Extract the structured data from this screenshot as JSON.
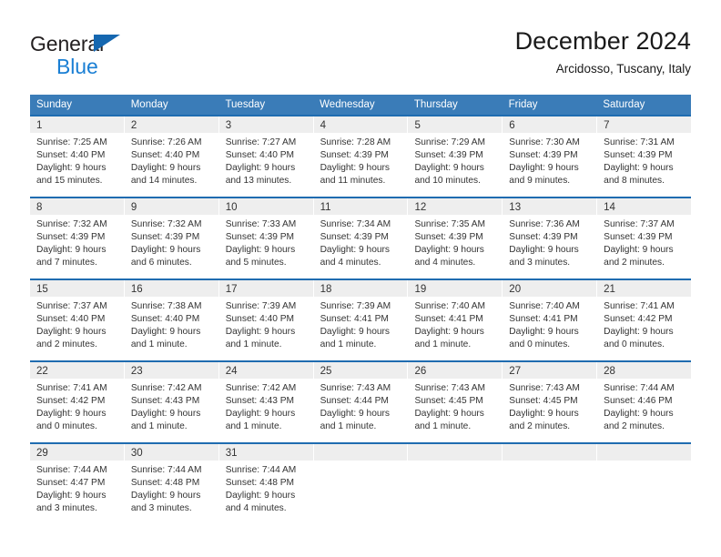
{
  "brand": {
    "name_top": "General",
    "name_bottom": "Blue",
    "flag_icon": "triangle-flag-icon",
    "color_dark": "#231f20",
    "color_blue": "#1a7fd4"
  },
  "header": {
    "title": "December 2024",
    "subtitle": "Arcidosso, Tuscany, Italy"
  },
  "theme": {
    "header_bg": "#3a7cb8",
    "row_divider": "#1f6cb0",
    "day_band_bg": "#eeeeee",
    "text": "#333333"
  },
  "weekdays": [
    "Sunday",
    "Monday",
    "Tuesday",
    "Wednesday",
    "Thursday",
    "Friday",
    "Saturday"
  ],
  "weeks": [
    [
      {
        "day": "1",
        "sunrise": "Sunrise: 7:25 AM",
        "sunset": "Sunset: 4:40 PM",
        "daylight_1": "Daylight: 9 hours",
        "daylight_2": "and 15 minutes."
      },
      {
        "day": "2",
        "sunrise": "Sunrise: 7:26 AM",
        "sunset": "Sunset: 4:40 PM",
        "daylight_1": "Daylight: 9 hours",
        "daylight_2": "and 14 minutes."
      },
      {
        "day": "3",
        "sunrise": "Sunrise: 7:27 AM",
        "sunset": "Sunset: 4:40 PM",
        "daylight_1": "Daylight: 9 hours",
        "daylight_2": "and 13 minutes."
      },
      {
        "day": "4",
        "sunrise": "Sunrise: 7:28 AM",
        "sunset": "Sunset: 4:39 PM",
        "daylight_1": "Daylight: 9 hours",
        "daylight_2": "and 11 minutes."
      },
      {
        "day": "5",
        "sunrise": "Sunrise: 7:29 AM",
        "sunset": "Sunset: 4:39 PM",
        "daylight_1": "Daylight: 9 hours",
        "daylight_2": "and 10 minutes."
      },
      {
        "day": "6",
        "sunrise": "Sunrise: 7:30 AM",
        "sunset": "Sunset: 4:39 PM",
        "daylight_1": "Daylight: 9 hours",
        "daylight_2": "and 9 minutes."
      },
      {
        "day": "7",
        "sunrise": "Sunrise: 7:31 AM",
        "sunset": "Sunset: 4:39 PM",
        "daylight_1": "Daylight: 9 hours",
        "daylight_2": "and 8 minutes."
      }
    ],
    [
      {
        "day": "8",
        "sunrise": "Sunrise: 7:32 AM",
        "sunset": "Sunset: 4:39 PM",
        "daylight_1": "Daylight: 9 hours",
        "daylight_2": "and 7 minutes."
      },
      {
        "day": "9",
        "sunrise": "Sunrise: 7:32 AM",
        "sunset": "Sunset: 4:39 PM",
        "daylight_1": "Daylight: 9 hours",
        "daylight_2": "and 6 minutes."
      },
      {
        "day": "10",
        "sunrise": "Sunrise: 7:33 AM",
        "sunset": "Sunset: 4:39 PM",
        "daylight_1": "Daylight: 9 hours",
        "daylight_2": "and 5 minutes."
      },
      {
        "day": "11",
        "sunrise": "Sunrise: 7:34 AM",
        "sunset": "Sunset: 4:39 PM",
        "daylight_1": "Daylight: 9 hours",
        "daylight_2": "and 4 minutes."
      },
      {
        "day": "12",
        "sunrise": "Sunrise: 7:35 AM",
        "sunset": "Sunset: 4:39 PM",
        "daylight_1": "Daylight: 9 hours",
        "daylight_2": "and 4 minutes."
      },
      {
        "day": "13",
        "sunrise": "Sunrise: 7:36 AM",
        "sunset": "Sunset: 4:39 PM",
        "daylight_1": "Daylight: 9 hours",
        "daylight_2": "and 3 minutes."
      },
      {
        "day": "14",
        "sunrise": "Sunrise: 7:37 AM",
        "sunset": "Sunset: 4:39 PM",
        "daylight_1": "Daylight: 9 hours",
        "daylight_2": "and 2 minutes."
      }
    ],
    [
      {
        "day": "15",
        "sunrise": "Sunrise: 7:37 AM",
        "sunset": "Sunset: 4:40 PM",
        "daylight_1": "Daylight: 9 hours",
        "daylight_2": "and 2 minutes."
      },
      {
        "day": "16",
        "sunrise": "Sunrise: 7:38 AM",
        "sunset": "Sunset: 4:40 PM",
        "daylight_1": "Daylight: 9 hours",
        "daylight_2": "and 1 minute."
      },
      {
        "day": "17",
        "sunrise": "Sunrise: 7:39 AM",
        "sunset": "Sunset: 4:40 PM",
        "daylight_1": "Daylight: 9 hours",
        "daylight_2": "and 1 minute."
      },
      {
        "day": "18",
        "sunrise": "Sunrise: 7:39 AM",
        "sunset": "Sunset: 4:41 PM",
        "daylight_1": "Daylight: 9 hours",
        "daylight_2": "and 1 minute."
      },
      {
        "day": "19",
        "sunrise": "Sunrise: 7:40 AM",
        "sunset": "Sunset: 4:41 PM",
        "daylight_1": "Daylight: 9 hours",
        "daylight_2": "and 1 minute."
      },
      {
        "day": "20",
        "sunrise": "Sunrise: 7:40 AM",
        "sunset": "Sunset: 4:41 PM",
        "daylight_1": "Daylight: 9 hours",
        "daylight_2": "and 0 minutes."
      },
      {
        "day": "21",
        "sunrise": "Sunrise: 7:41 AM",
        "sunset": "Sunset: 4:42 PM",
        "daylight_1": "Daylight: 9 hours",
        "daylight_2": "and 0 minutes."
      }
    ],
    [
      {
        "day": "22",
        "sunrise": "Sunrise: 7:41 AM",
        "sunset": "Sunset: 4:42 PM",
        "daylight_1": "Daylight: 9 hours",
        "daylight_2": "and 0 minutes."
      },
      {
        "day": "23",
        "sunrise": "Sunrise: 7:42 AM",
        "sunset": "Sunset: 4:43 PM",
        "daylight_1": "Daylight: 9 hours",
        "daylight_2": "and 1 minute."
      },
      {
        "day": "24",
        "sunrise": "Sunrise: 7:42 AM",
        "sunset": "Sunset: 4:43 PM",
        "daylight_1": "Daylight: 9 hours",
        "daylight_2": "and 1 minute."
      },
      {
        "day": "25",
        "sunrise": "Sunrise: 7:43 AM",
        "sunset": "Sunset: 4:44 PM",
        "daylight_1": "Daylight: 9 hours",
        "daylight_2": "and 1 minute."
      },
      {
        "day": "26",
        "sunrise": "Sunrise: 7:43 AM",
        "sunset": "Sunset: 4:45 PM",
        "daylight_1": "Daylight: 9 hours",
        "daylight_2": "and 1 minute."
      },
      {
        "day": "27",
        "sunrise": "Sunrise: 7:43 AM",
        "sunset": "Sunset: 4:45 PM",
        "daylight_1": "Daylight: 9 hours",
        "daylight_2": "and 2 minutes."
      },
      {
        "day": "28",
        "sunrise": "Sunrise: 7:44 AM",
        "sunset": "Sunset: 4:46 PM",
        "daylight_1": "Daylight: 9 hours",
        "daylight_2": "and 2 minutes."
      }
    ],
    [
      {
        "day": "29",
        "sunrise": "Sunrise: 7:44 AM",
        "sunset": "Sunset: 4:47 PM",
        "daylight_1": "Daylight: 9 hours",
        "daylight_2": "and 3 minutes."
      },
      {
        "day": "30",
        "sunrise": "Sunrise: 7:44 AM",
        "sunset": "Sunset: 4:48 PM",
        "daylight_1": "Daylight: 9 hours",
        "daylight_2": "and 3 minutes."
      },
      {
        "day": "31",
        "sunrise": "Sunrise: 7:44 AM",
        "sunset": "Sunset: 4:48 PM",
        "daylight_1": "Daylight: 9 hours",
        "daylight_2": "and 4 minutes."
      },
      {
        "day": "",
        "sunrise": "",
        "sunset": "",
        "daylight_1": "",
        "daylight_2": ""
      },
      {
        "day": "",
        "sunrise": "",
        "sunset": "",
        "daylight_1": "",
        "daylight_2": ""
      },
      {
        "day": "",
        "sunrise": "",
        "sunset": "",
        "daylight_1": "",
        "daylight_2": ""
      },
      {
        "day": "",
        "sunrise": "",
        "sunset": "",
        "daylight_1": "",
        "daylight_2": ""
      }
    ]
  ]
}
